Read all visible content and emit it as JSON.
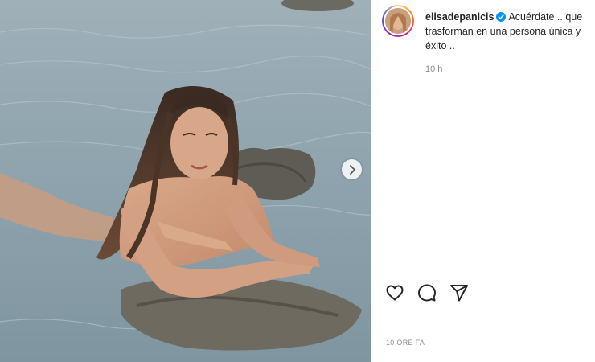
{
  "post": {
    "username": "elisadepanicis",
    "caption_line1": "Acuérdate .. que",
    "caption_line2": "trasforman en una persona única y",
    "caption_line3": "éxito ..",
    "comment_time": "10 h",
    "posted_ago": "10 ORE FA"
  },
  "image": {
    "description_icon": "beach-photo",
    "carousel_next_icon": "chevron-right-icon"
  },
  "actions": [
    "like-heart-icon",
    "comment-bubble-icon",
    "share-paper-plane-icon"
  ],
  "colors": {
    "text": "#262626",
    "secondary_text": "#8e8e8e",
    "verified_blue": "#0095f6",
    "border": "#efefef"
  }
}
